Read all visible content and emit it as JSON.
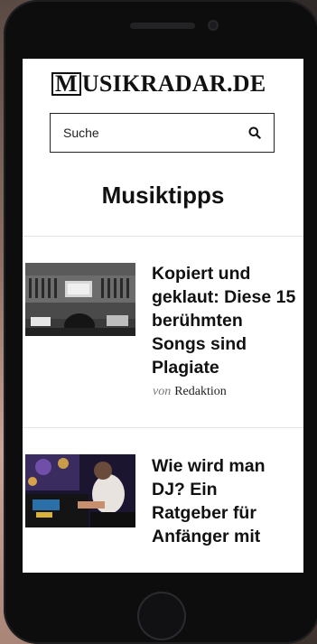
{
  "site": {
    "logo_initial": "M",
    "logo_rest": "USIKRADAR.DE"
  },
  "search": {
    "placeholder": "Suche",
    "icon": "search-icon"
  },
  "section": {
    "title": "Musiktipps"
  },
  "articles": [
    {
      "title": "Kopiert und geklaut: Diese 15 berühmten Songs sind Plagiate",
      "byline_prefix": "von",
      "author": "Redaktion",
      "thumbnail": "mixing-console-photo"
    },
    {
      "title": "Wie wird man DJ? Ein Ratgeber für Anfänger mit",
      "thumbnail": "dj-at-party-photo"
    }
  ]
}
